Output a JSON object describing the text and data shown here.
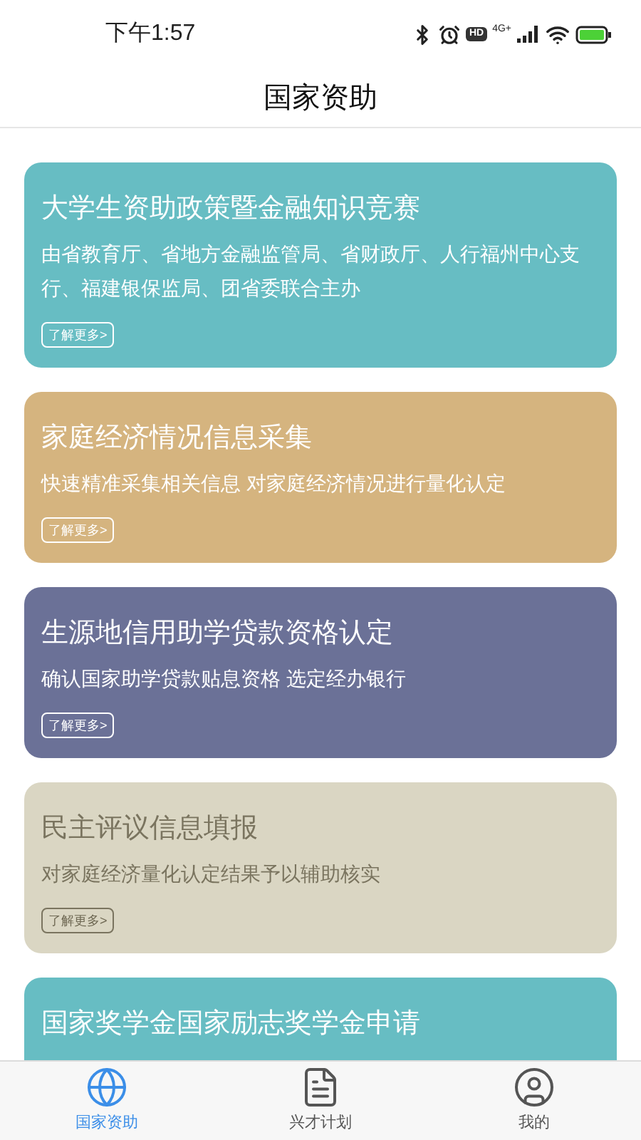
{
  "status_bar": {
    "time": "下午1:57",
    "hd_badge": "HD",
    "network": "4G+"
  },
  "header": {
    "title": "国家资助"
  },
  "cards": [
    {
      "title": "大学生资助政策暨金融知识竞赛",
      "description": "由省教育厅、省地方金融监管局、省财政厅、人行福州中心支行、福建银保监局、团省委联合主办",
      "button": "了解更多>",
      "color": "#67bdc3",
      "faded": false
    },
    {
      "title": "家庭经济情况信息采集",
      "description": "快速精准采集相关信息 对家庭经济情况进行量化认定",
      "button": "了解更多>",
      "color": "#d5b47f",
      "faded": false
    },
    {
      "title": "生源地信用助学贷款资格认定",
      "description": "确认国家助学贷款贴息资格 选定经办银行",
      "button": "了解更多>",
      "color": "#6b7197",
      "faded": false
    },
    {
      "title": "民主评议信息填报",
      "description": "对家庭经济量化认定结果予以辅助核实",
      "button": "了解更多>",
      "color": "#dad6c3",
      "faded": true
    },
    {
      "title": "国家奖学金国家励志奖学金申请",
      "color": "#67bdc3",
      "faded": false
    }
  ],
  "tab_bar": [
    {
      "label": "国家资助",
      "selected": true
    },
    {
      "label": "兴才计划",
      "selected": false
    },
    {
      "label": "我的",
      "selected": false
    }
  ]
}
